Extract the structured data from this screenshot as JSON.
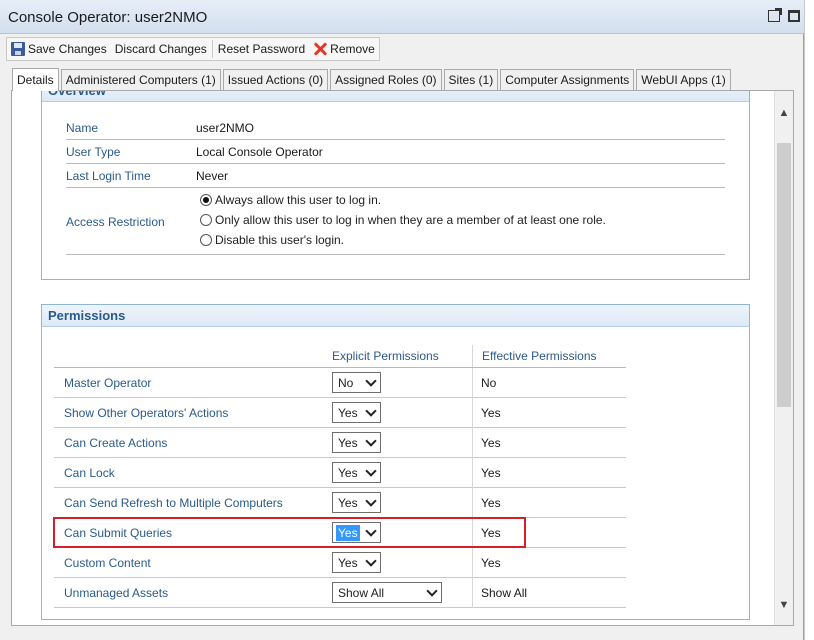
{
  "window": {
    "title": "Console Operator: user2NMO"
  },
  "toolbar": {
    "save_label": "Save Changes",
    "discard_label": "Discard Changes",
    "reset_label": "Reset Password",
    "remove_label": "Remove"
  },
  "tabs": [
    {
      "label": "Details",
      "active": true
    },
    {
      "label": "Administered Computers (1)"
    },
    {
      "label": "Issued Actions (0)"
    },
    {
      "label": "Assigned Roles (0)"
    },
    {
      "label": "Sites (1)"
    },
    {
      "label": "Computer Assignments"
    },
    {
      "label": "WebUI Apps (1)"
    }
  ],
  "overview": {
    "header": "Overview",
    "name_label": "Name",
    "name_value": "user2NMO",
    "user_type_label": "User Type",
    "user_type_value": "Local Console Operator",
    "last_login_label": "Last Login Time",
    "last_login_value": "Never",
    "access_label": "Access Restriction",
    "access_options": [
      {
        "label": "Always allow this user to log in.",
        "checked": true
      },
      {
        "label": "Only allow this user to log in when they are a member of at least one role.",
        "checked": false
      },
      {
        "label": "Disable this user's login.",
        "checked": false
      }
    ]
  },
  "permissions": {
    "header": "Permissions",
    "col_explicit": "Explicit Permissions",
    "col_effective": "Effective Permissions",
    "rows": [
      {
        "label": "Master Operator",
        "explicit": "No",
        "effective": "No"
      },
      {
        "label": "Show Other Operators' Actions",
        "explicit": "Yes",
        "effective": "Yes"
      },
      {
        "label": "Can Create Actions",
        "explicit": "Yes",
        "effective": "Yes"
      },
      {
        "label": "Can Lock",
        "explicit": "Yes",
        "effective": "Yes"
      },
      {
        "label": "Can Send Refresh to Multiple Computers",
        "explicit": "Yes",
        "effective": "Yes"
      },
      {
        "label": "Can Submit Queries",
        "explicit": "Yes",
        "effective": "Yes"
      },
      {
        "label": "Custom Content",
        "explicit": "Yes",
        "effective": "Yes"
      },
      {
        "label": "Unmanaged Assets",
        "explicit": "Show All",
        "effective": "Show All"
      }
    ]
  },
  "colors": {
    "highlight_border": "#d4202a",
    "section_border": "#8fb6d8",
    "label_blue": "#2a5a8a",
    "selection_blue": "#3399ff"
  },
  "icons": [
    "save-icon",
    "remove-icon",
    "popout-icon",
    "maximize-icon",
    "chevron-down-icon",
    "scroll-up-icon",
    "scroll-down-icon"
  ]
}
